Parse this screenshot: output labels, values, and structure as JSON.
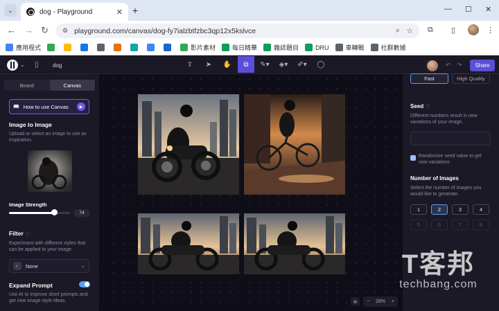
{
  "browser": {
    "tab_title": "dog - Playground",
    "tab_close": "✕",
    "new_tab": "+",
    "minimize": "—",
    "maximize": "☐",
    "close": "✕",
    "url": "playground.com/canvas/dog-fy7ialzbtfzbc3qp12x5kslvce",
    "bookmarks": [
      {
        "label": "應用程式",
        "color": "#4285f4"
      },
      {
        "label": "",
        "color": "#34a853"
      },
      {
        "label": "",
        "color": "#fbbc05"
      },
      {
        "label": "",
        "color": "#1a73e8"
      },
      {
        "label": "",
        "color": "#5f6368"
      },
      {
        "label": "",
        "color": "#e8710a"
      },
      {
        "label": "",
        "color": "#12a4af"
      },
      {
        "label": "",
        "color": "#4285f4"
      },
      {
        "label": "",
        "color": "#1967d2"
      },
      {
        "label": "影片素材",
        "color": "#34a853"
      },
      {
        "label": "每日精華",
        "color": "#0f9d58"
      },
      {
        "label": "雜誌題目",
        "color": "#0f9d58"
      },
      {
        "label": "DRU",
        "color": "#0f9d58"
      },
      {
        "label": "車轉戰",
        "color": "#5f6368"
      },
      {
        "label": "社群數據",
        "color": "#5f6368"
      }
    ]
  },
  "app": {
    "project_name": "dog",
    "share_label": "Share"
  },
  "left_panel": {
    "tabs": [
      "Board",
      "Canvas"
    ],
    "active_tab": "Canvas",
    "how_to": "How to use Canvas",
    "image_to_image": {
      "title": "Image to Image",
      "desc": "Upload or select an image to use as inspiration."
    },
    "strength": {
      "title": "Image Strength",
      "value": "74",
      "fraction": 0.74
    },
    "filter": {
      "title": "Filter",
      "desc": "Experiment with different styles that can be applied to your image.",
      "selected": "None"
    },
    "expand_prompt": {
      "title": "Expand Prompt",
      "desc": "Use AI to improve short prompts and get new image style ideas.",
      "enabled": true
    }
  },
  "right_panel": {
    "speed_options": [
      "Fast",
      "High Quality"
    ],
    "selected_speed": "Fast",
    "seed": {
      "title": "Seed",
      "desc": "Different numbers result in new variations of your image."
    },
    "randomize_label": "Randomize seed value to get new variations",
    "num_images": {
      "title": "Number of Images",
      "desc": "Select the number of images you would like to generate.",
      "options": [
        "1",
        "2",
        "3",
        "4",
        "5",
        "6",
        "7",
        "8"
      ],
      "selected": "2"
    }
  },
  "canvas": {
    "zoom": "28%",
    "zoom_minus": "−",
    "zoom_plus": "+"
  },
  "watermark": {
    "big": "T客邦",
    "small": "techbang.com"
  },
  "colors": {
    "accent": "#5a4fd6",
    "toggle_on": "#5a9ef0"
  }
}
